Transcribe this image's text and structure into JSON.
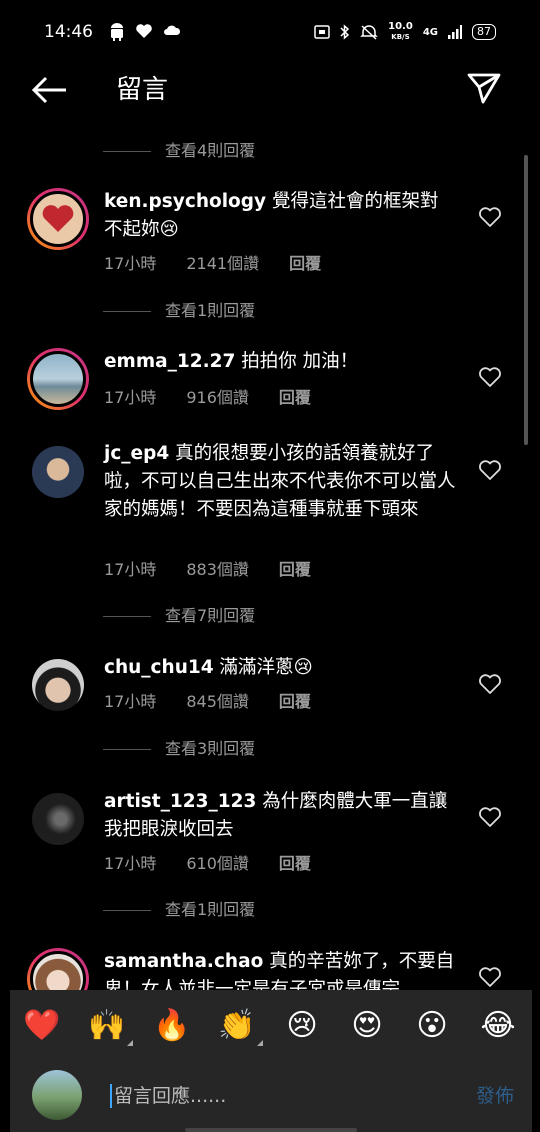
{
  "status_bar": {
    "time": "14:46",
    "left_icons": [
      "android-icon",
      "heart-icon",
      "cloud-icon"
    ],
    "net_speed": "10.0",
    "net_unit": "KB/S",
    "signal": "4G",
    "battery": "87"
  },
  "header": {
    "title": "留言"
  },
  "comments": [
    {
      "replies_toggle": "查看4則回覆"
    },
    {
      "username": "ken.psychology",
      "text": "覺得這社會的框架對不起妳😢",
      "time": "17小時",
      "likes": "2141個讚",
      "reply": "回覆"
    },
    {
      "replies_toggle": "查看1則回覆"
    },
    {
      "username": "emma_12.27",
      "text": "拍拍你 加油！",
      "time": "17小時",
      "likes": "916個讚",
      "reply": "回覆"
    },
    {
      "username": "jc_ep4",
      "text": "真的很想要小孩的話領養就好了啦，不可以自己生出來不代表你不可以當人家的媽媽！不要因為這種事就垂下頭來",
      "time": "17小時",
      "likes": "883個讚",
      "reply": "回覆"
    },
    {
      "replies_toggle": "查看7則回覆"
    },
    {
      "username": "chu_chu14",
      "text": "滿滿洋蔥😢",
      "time": "17小時",
      "likes": "845個讚",
      "reply": "回覆"
    },
    {
      "replies_toggle": "查看3則回覆"
    },
    {
      "username": "artist_123_123",
      "text": "為什麼肉體大軍一直讓我把眼淚收回去",
      "time": "17小時",
      "likes": "610個讚",
      "reply": "回覆"
    },
    {
      "replies_toggle": "查看1則回覆"
    },
    {
      "username": "samantha.chao",
      "text": "真的辛苦妳了，不要自卑！女人並非一定是有子宮或是傳宗"
    }
  ],
  "emoji_bar": [
    "❤️",
    "🙌",
    "🔥",
    "👏",
    "😢",
    "😍",
    "😮",
    "😂"
  ],
  "reply_input": {
    "placeholder": "留言回應......",
    "post_label": "發佈"
  },
  "colors": {
    "background": "#000000",
    "secondary_text": "#9a9a9a",
    "panel": "#262626",
    "post_button": "#2d5d8a",
    "story_ring": "#e1306c"
  }
}
